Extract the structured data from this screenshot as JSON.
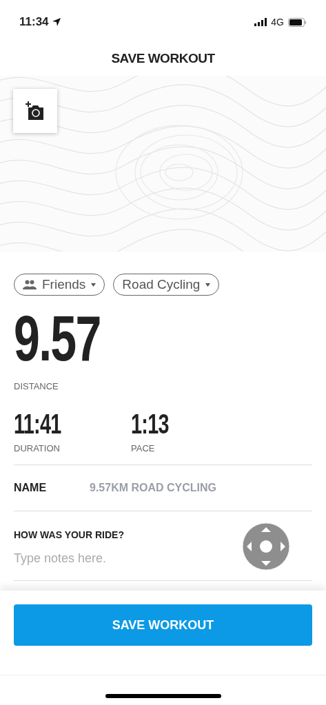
{
  "status_bar": {
    "time": "11:34",
    "network": "4G"
  },
  "header": {
    "title": "SAVE WORKOUT"
  },
  "chips": [
    {
      "label": "Friends",
      "kind": "people"
    },
    {
      "label": "Road Cycling",
      "kind": "plain"
    }
  ],
  "distance": {
    "value": "9.57",
    "label": "DISTANCE"
  },
  "stats": [
    {
      "value": "11:41",
      "label": "DURATION"
    },
    {
      "value": "1:13",
      "label": "PACE"
    }
  ],
  "name_field": {
    "label": "NAME",
    "placeholder": "9.57KM ROAD CYCLING"
  },
  "notes_field": {
    "label": "HOW WAS YOUR RIDE?",
    "placeholder": "Type notes here."
  },
  "save_button": {
    "label": "SAVE WORKOUT"
  }
}
